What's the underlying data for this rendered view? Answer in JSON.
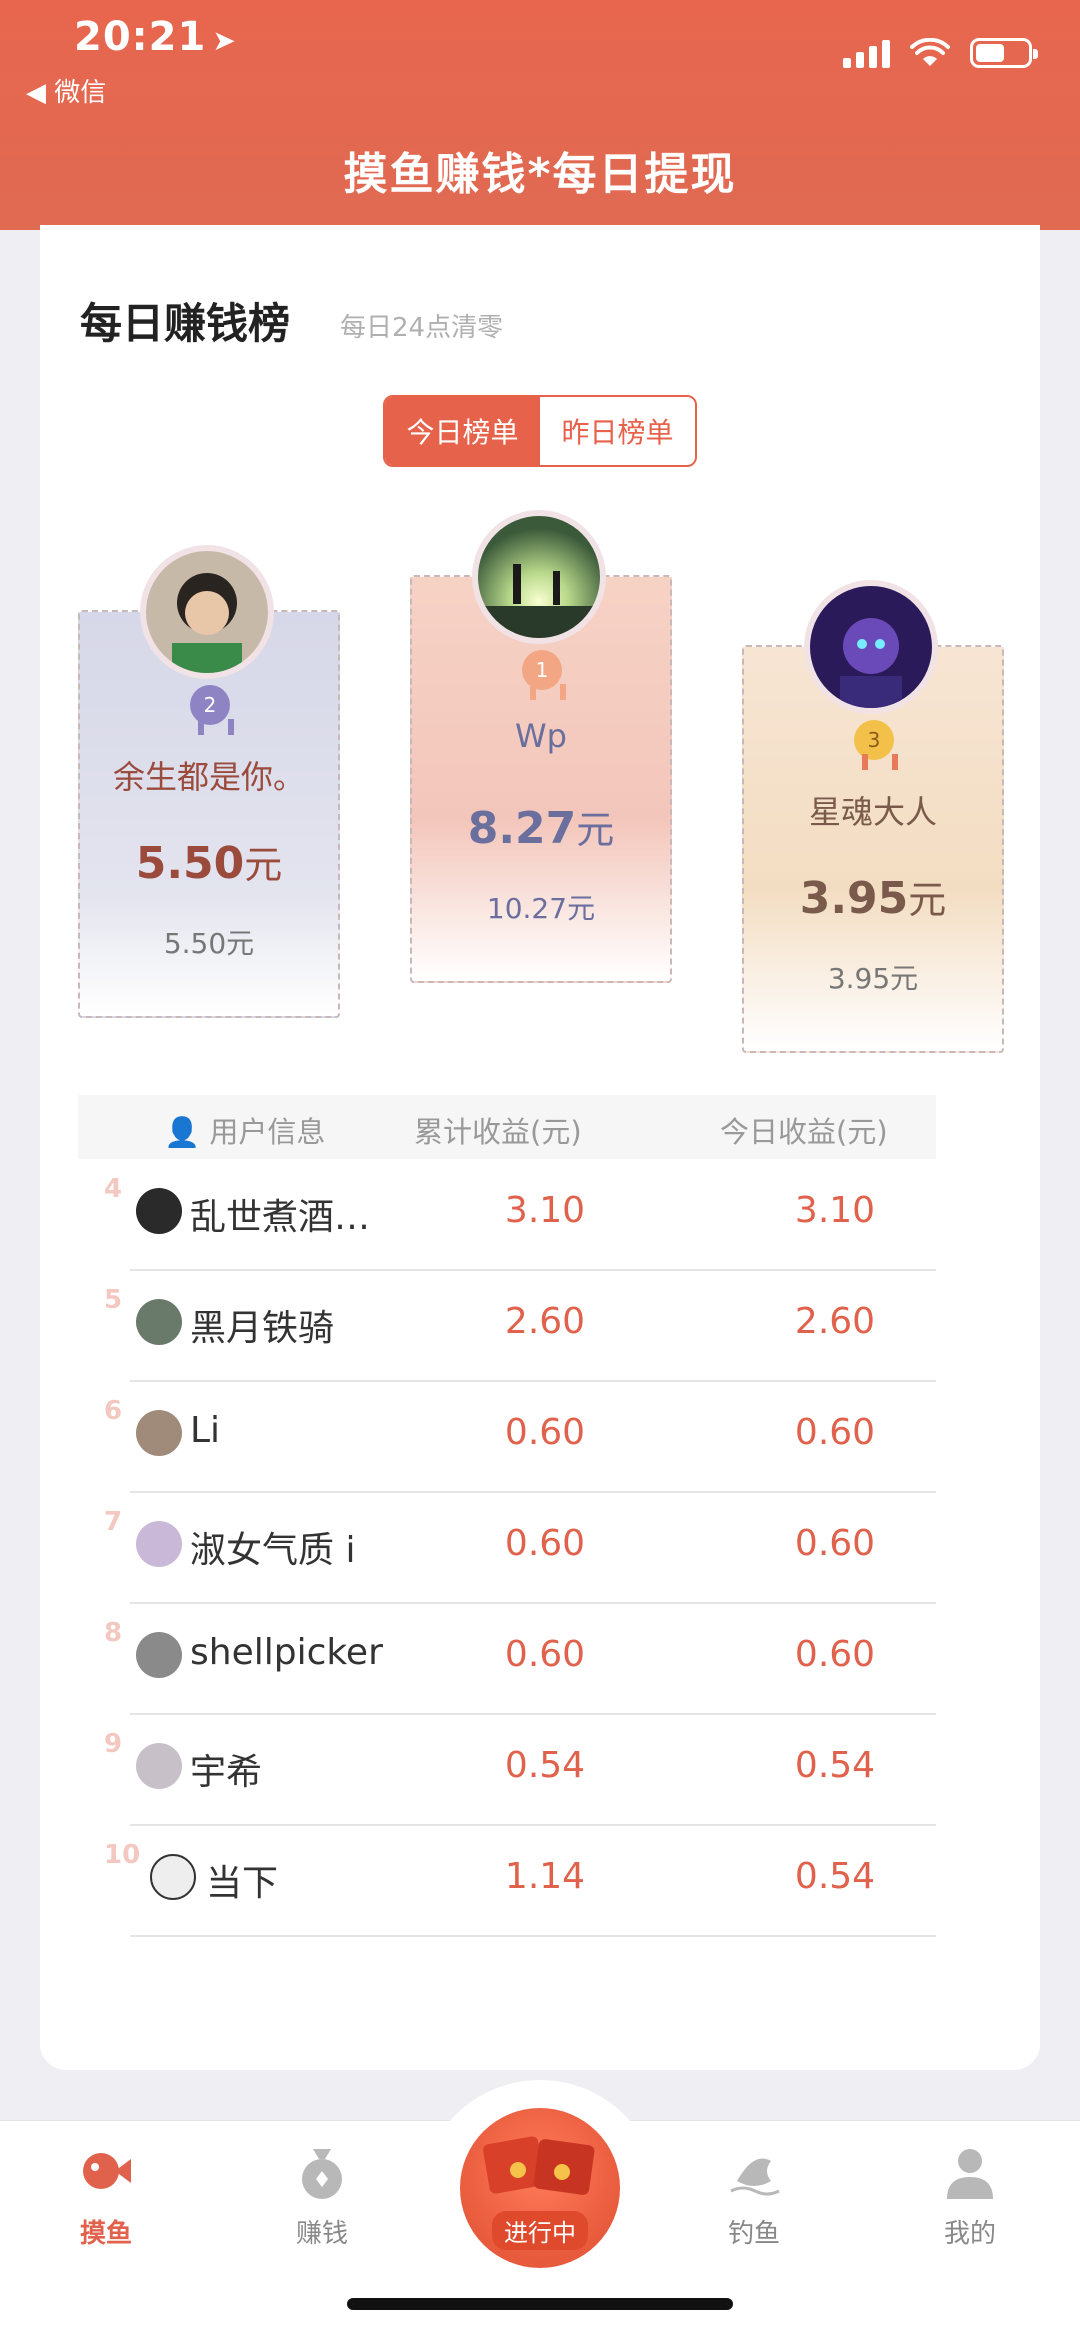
{
  "status_bar": {
    "time": "20:21",
    "back_app": "◀ 微信"
  },
  "header": {
    "title": "摸鱼赚钱*每日提现"
  },
  "ranking": {
    "title": "每日赚钱榜",
    "subtitle": "每日24点清零",
    "tabs": [
      "今日榜单",
      "昨日榜单"
    ],
    "active_tab": "今日榜单"
  },
  "podium": [
    {
      "rank": "2",
      "name": "余生都是你。",
      "amount": "5.50",
      "unit": "元",
      "total": "5.50元"
    },
    {
      "rank": "1",
      "name": "Wp",
      "amount": "8.27",
      "unit": "元",
      "total": "10.27元"
    },
    {
      "rank": "3",
      "name": "星魂大人",
      "amount": "3.95",
      "unit": "元",
      "total": "3.95元"
    }
  ],
  "table": {
    "headers": [
      "用户信息",
      "累计收益(元)",
      "今日收益(元)"
    ],
    "rows": [
      {
        "rank": "4",
        "name": "乱世煮酒…",
        "total": "3.10",
        "today": "3.10"
      },
      {
        "rank": "5",
        "name": "黑月铁骑",
        "total": "2.60",
        "today": "2.60"
      },
      {
        "rank": "6",
        "name": "Li",
        "total": "0.60",
        "today": "0.60"
      },
      {
        "rank": "7",
        "name": "淑女气质 i",
        "total": "0.60",
        "today": "0.60"
      },
      {
        "rank": "8",
        "name": "shellpicker",
        "total": "0.60",
        "today": "0.60"
      },
      {
        "rank": "9",
        "name": "宇希",
        "total": "0.54",
        "today": "0.54"
      },
      {
        "rank": "10",
        "name": "当下",
        "total": "1.14",
        "today": "0.54"
      }
    ]
  },
  "tabbar": {
    "items": [
      {
        "label": "摸鱼",
        "icon": "fish-icon",
        "active": true
      },
      {
        "label": "赚钱",
        "icon": "money-bag-icon",
        "active": false
      },
      {
        "label": "进行中",
        "icon": "red-envelope-icon",
        "active": false
      },
      {
        "label": "钓鱼",
        "icon": "fishing-icon",
        "active": false
      },
      {
        "label": "我的",
        "icon": "profile-icon",
        "active": false
      }
    ]
  },
  "colors": {
    "brand": "#e6624a",
    "amount": "#e0624c",
    "podium_text": "#9b4b3c"
  }
}
